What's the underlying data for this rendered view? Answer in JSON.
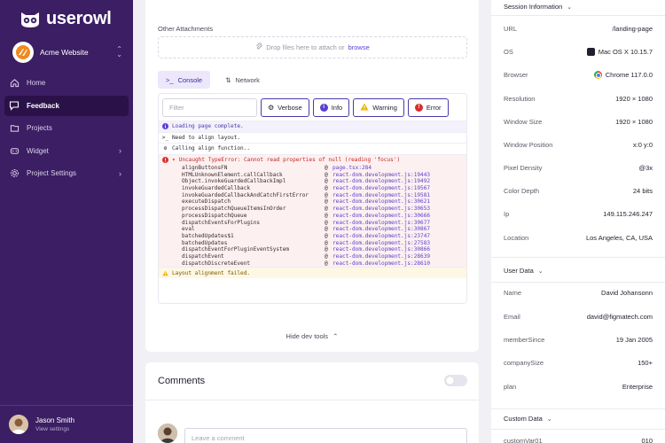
{
  "brand": {
    "name": "userowl"
  },
  "workspace": {
    "name": "Acme Website"
  },
  "nav": {
    "items": [
      {
        "label": "Home",
        "icon": "home-icon",
        "active": false,
        "arrow": ""
      },
      {
        "label": "Feedback",
        "icon": "feedback-icon",
        "active": true,
        "arrow": ""
      },
      {
        "label": "Projects",
        "icon": "folder-icon",
        "active": false,
        "arrow": ""
      },
      {
        "label": "Widget",
        "icon": "widget-icon",
        "active": false,
        "arrow": "›"
      },
      {
        "label": "Project Settings",
        "icon": "gear-icon",
        "active": false,
        "arrow": "›"
      }
    ]
  },
  "user": {
    "name": "Jason Smith",
    "sub": "View settings"
  },
  "attachments": {
    "label": "Other Attachments",
    "drop_text": "Drop files here to attach or",
    "browse": "browse"
  },
  "devtabs": [
    {
      "label": "Console",
      "icon": ">_",
      "active": true
    },
    {
      "label": "Network",
      "icon": "⇅",
      "active": false
    }
  ],
  "filter": {
    "placeholder": "Filter"
  },
  "levels": [
    {
      "label": "Verbose",
      "color": "#ffffff",
      "glyph": "⚙"
    },
    {
      "label": "Info",
      "color": "#5b3fd1",
      "glyph": "i"
    },
    {
      "label": "Warning",
      "color": "#f2b200",
      "glyph": "!"
    },
    {
      "label": "Error",
      "color": "#d62f2f",
      "glyph": "!"
    }
  ],
  "logs": {
    "info_line": "Loading page complete.",
    "normal_line": "Need to align layout.",
    "verbose_line": "Calling align function..",
    "error_head": "Uncaught TypeError: Cannot read properties of null (reading 'focus')",
    "stack": [
      {
        "fn": "alignButtonsFN",
        "src": "page.tsx:284"
      },
      {
        "fn": "HTMLUnknownElement.callCallback",
        "src": "react-dom.development.js:19443"
      },
      {
        "fn": "Object.invokeGuardedCallbackImpl",
        "src": "react-dom.development.js:19492"
      },
      {
        "fn": "invokeGuardedCallback",
        "src": "react-dom.development.js:19567"
      },
      {
        "fn": "invokeGuardedCallbackAndCatchFirstError",
        "src": "react-dom.development.js:19581"
      },
      {
        "fn": "executeDispatch",
        "src": "react-dom.development.js:30621"
      },
      {
        "fn": "processDispatchQueueItemsInOrder",
        "src": "react-dom.development.js:30653"
      },
      {
        "fn": "processDispatchQueue",
        "src": "react-dom.development.js:30666"
      },
      {
        "fn": "dispatchEventsForPlugins",
        "src": "react-dom.development.js:30677"
      },
      {
        "fn": "eval",
        "src": "react-dom.development.js:30867"
      },
      {
        "fn": "batchedUpdates$1",
        "src": "react-dom.development.js:23747"
      },
      {
        "fn": "batchedUpdates",
        "src": "react-dom.development.js:27583"
      },
      {
        "fn": "dispatchEventForPluginEventSystem",
        "src": "react-dom.development.js:30866"
      },
      {
        "fn": "dispatchEvent",
        "src": "react-dom.development.js:28639"
      },
      {
        "fn": "dispatchDiscreteEvent",
        "src": "react-dom.development.js:28610"
      }
    ],
    "warning_line": "Layout alignment failed."
  },
  "hide_dev": "Hide dev tools",
  "comments": {
    "title": "Comments",
    "placeholder": "Leave a comment"
  },
  "session": {
    "title": "Session Information",
    "rows": [
      {
        "key": "URL",
        "value": "/landing-page",
        "icon": ""
      },
      {
        "key": "OS",
        "value": "Mac OS X 10.15.7",
        "icon": "apple-icon"
      },
      {
        "key": "Browser",
        "value": "Chrome 117.0.0",
        "icon": "chrome-icon"
      },
      {
        "key": "Resolution",
        "value": "1920 × 1080",
        "icon": ""
      },
      {
        "key": "Window Size",
        "value": "1920 × 1080",
        "icon": ""
      },
      {
        "key": "Window Position",
        "value": "x:0 y:0",
        "icon": ""
      },
      {
        "key": "Pixel Density",
        "value": "@3x",
        "icon": ""
      },
      {
        "key": "Color Depth",
        "value": "24 bits",
        "icon": ""
      },
      {
        "key": "Ip",
        "value": "149.115.246.247",
        "icon": ""
      },
      {
        "key": "Location",
        "value": "Los Angeles, CA, USA",
        "icon": ""
      }
    ]
  },
  "user_data": {
    "title": "User Data",
    "rows": [
      {
        "key": "Name",
        "value": "David Johansonn"
      },
      {
        "key": "Email",
        "value": "david@figmatech.com"
      },
      {
        "key": "memberSince",
        "value": "19 Jan 2005"
      },
      {
        "key": "companySize",
        "value": "150+"
      },
      {
        "key": "plan",
        "value": "Enterprise"
      }
    ]
  },
  "custom_data": {
    "title": "Custom Data",
    "rows": [
      {
        "key": "customVar01",
        "value": "010"
      }
    ]
  },
  "colors": {
    "sidebar": "#3b1e63",
    "accent": "#5b3fd1",
    "error": "#d62f2f",
    "warning": "#f2b200"
  }
}
